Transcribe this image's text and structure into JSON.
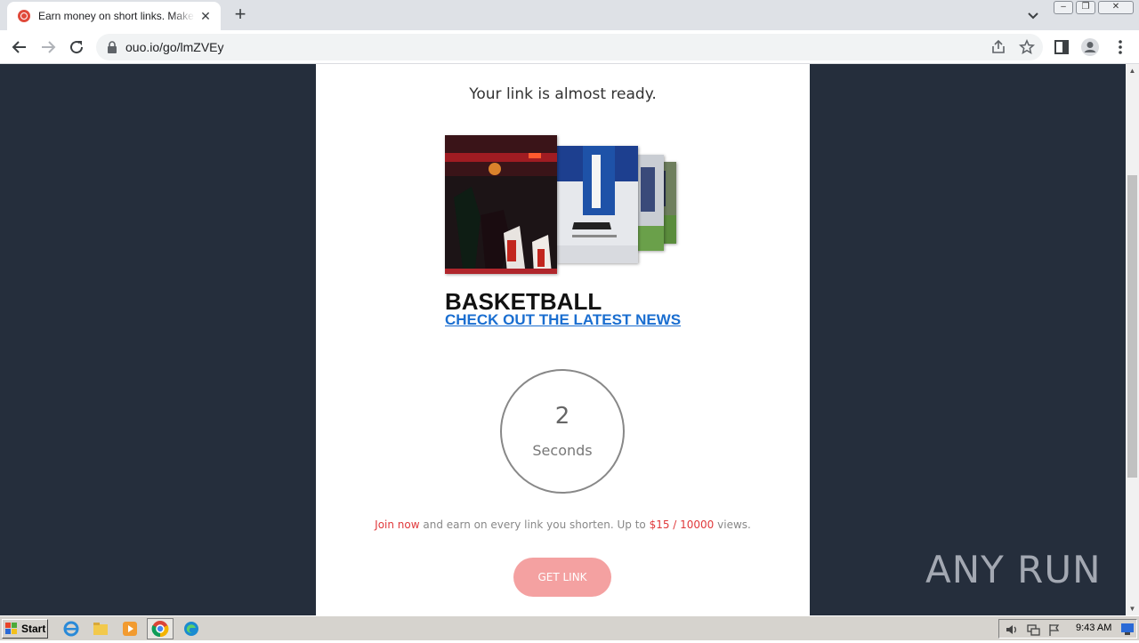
{
  "browser": {
    "tab_title": "Earn money on short links. Make short links and earn the biggest money",
    "tab_close": "✕",
    "new_tab": "+",
    "url": "ouo.io/go/lmZVEy",
    "window_buttons": [
      "minimize",
      "restore",
      "close"
    ]
  },
  "page": {
    "headline": "Your link is almost ready.",
    "ad": {
      "title": "BASKETBALL",
      "link": "CHECK OUT THE LATEST NEWS"
    },
    "timer": {
      "value": "2",
      "unit": "Seconds"
    },
    "promo": {
      "join": "Join now",
      "middle": " and earn on every link you shorten. Up to ",
      "rate": "$15 / 10000",
      "end": " views."
    },
    "get_link_label": "GET LINK",
    "watermark": "ANY RUN"
  },
  "taskbar": {
    "start_label": "Start",
    "clock": "9:43 AM"
  },
  "colors": {
    "page_bg": "#252e3c",
    "accent_red": "#e0393b",
    "button_pink": "#f4a1a1",
    "link_blue": "#1a6ed0"
  }
}
